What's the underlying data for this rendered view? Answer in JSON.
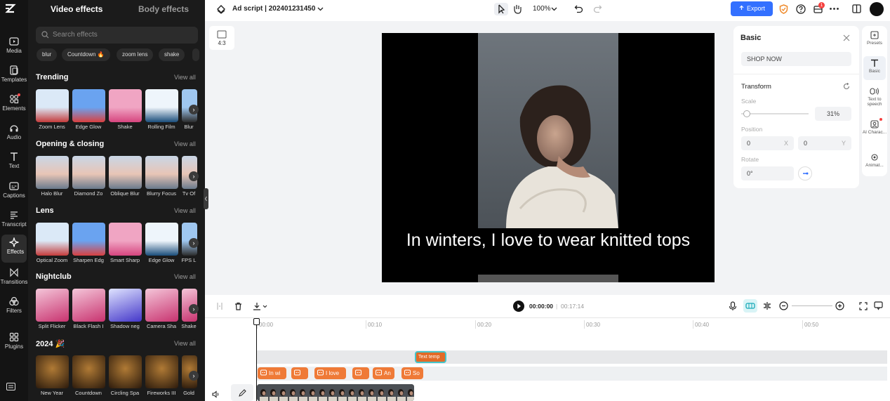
{
  "rail": {
    "items": [
      {
        "label": "Media",
        "icon": "media-icon"
      },
      {
        "label": "Templates",
        "icon": "templates-icon"
      },
      {
        "label": "Elements",
        "icon": "elements-icon"
      },
      {
        "label": "Audio",
        "icon": "audio-icon"
      },
      {
        "label": "Text",
        "icon": "text-icon"
      },
      {
        "label": "Captions",
        "icon": "captions-icon"
      },
      {
        "label": "Transcript",
        "icon": "transcript-icon"
      },
      {
        "label": "Effects",
        "icon": "effects-icon"
      },
      {
        "label": "Transitions",
        "icon": "transitions-icon"
      },
      {
        "label": "Filters",
        "icon": "filters-icon"
      },
      {
        "label": "Plugins",
        "icon": "plugins-icon"
      }
    ]
  },
  "effects": {
    "tabs": [
      "Video effects",
      "Body effects"
    ],
    "search_placeholder": "Search effects",
    "chips": [
      "blur",
      "Countdown 🔥",
      "zoom lens",
      "shake"
    ],
    "view_all": "View all",
    "sections": [
      {
        "title": "Trending",
        "items": [
          "Zoom Lens",
          "Edge Glow",
          "Shake",
          "Rolling Film",
          "Blur"
        ]
      },
      {
        "title": "Opening & closing",
        "items": [
          "Halo Blur",
          "Diamond Zo",
          "Oblique Blur",
          "Blurry Focus",
          "Tv Of"
        ]
      },
      {
        "title": "Lens",
        "items": [
          "Optical Zoom",
          "Sharpen Edg",
          "Smart Sharp",
          "Edge Glow",
          "FPS L"
        ]
      },
      {
        "title": "Nightclub",
        "items": [
          "Split Flicker",
          "Black Flash I",
          "Shadow neg",
          "Camera Sha",
          "Shake"
        ]
      },
      {
        "title": "2024 🎉",
        "items": [
          "New Year",
          "Countdown",
          "Circling Spa",
          "Fireworks III",
          "Gold"
        ]
      }
    ]
  },
  "topbar": {
    "project_title": "Ad script | 202401231450",
    "zoom": "100%",
    "export_label": "Export",
    "notification_count": "1"
  },
  "canvas": {
    "ratio_label": "4:3",
    "caption": "In winters, I love to wear knitted tops"
  },
  "basic_panel": {
    "title": "Basic",
    "text_value": "SHOP NOW",
    "transform_label": "Transform",
    "scale_label": "Scale",
    "scale_value": "31%",
    "scale_fraction": 0.03,
    "position_label": "Position",
    "pos_x": "0",
    "pos_x_axis": "X",
    "pos_y": "0",
    "pos_y_axis": "Y",
    "rotate_label": "Rotate",
    "rotate_value": "0°"
  },
  "right_tools": [
    {
      "label": "Presets",
      "icon": "presets-icon"
    },
    {
      "label": "Basic",
      "icon": "text-t-icon"
    },
    {
      "label": "Text to speech",
      "icon": "text-to-speech-icon"
    },
    {
      "label": "AI Charac...",
      "icon": "ai-character-icon"
    },
    {
      "label": "Animat...",
      "icon": "animation-icon"
    }
  ],
  "timeline": {
    "current_time": "00:00:00",
    "separator": "|",
    "total_time": "00:17:14",
    "ticks": [
      "00:00",
      "00:10",
      "00:20",
      "00:30",
      "00:40",
      "00:50"
    ],
    "text_clip": "Text temp",
    "caption_clips": [
      "In wi",
      "",
      "I love",
      "",
      "An",
      "So"
    ]
  }
}
